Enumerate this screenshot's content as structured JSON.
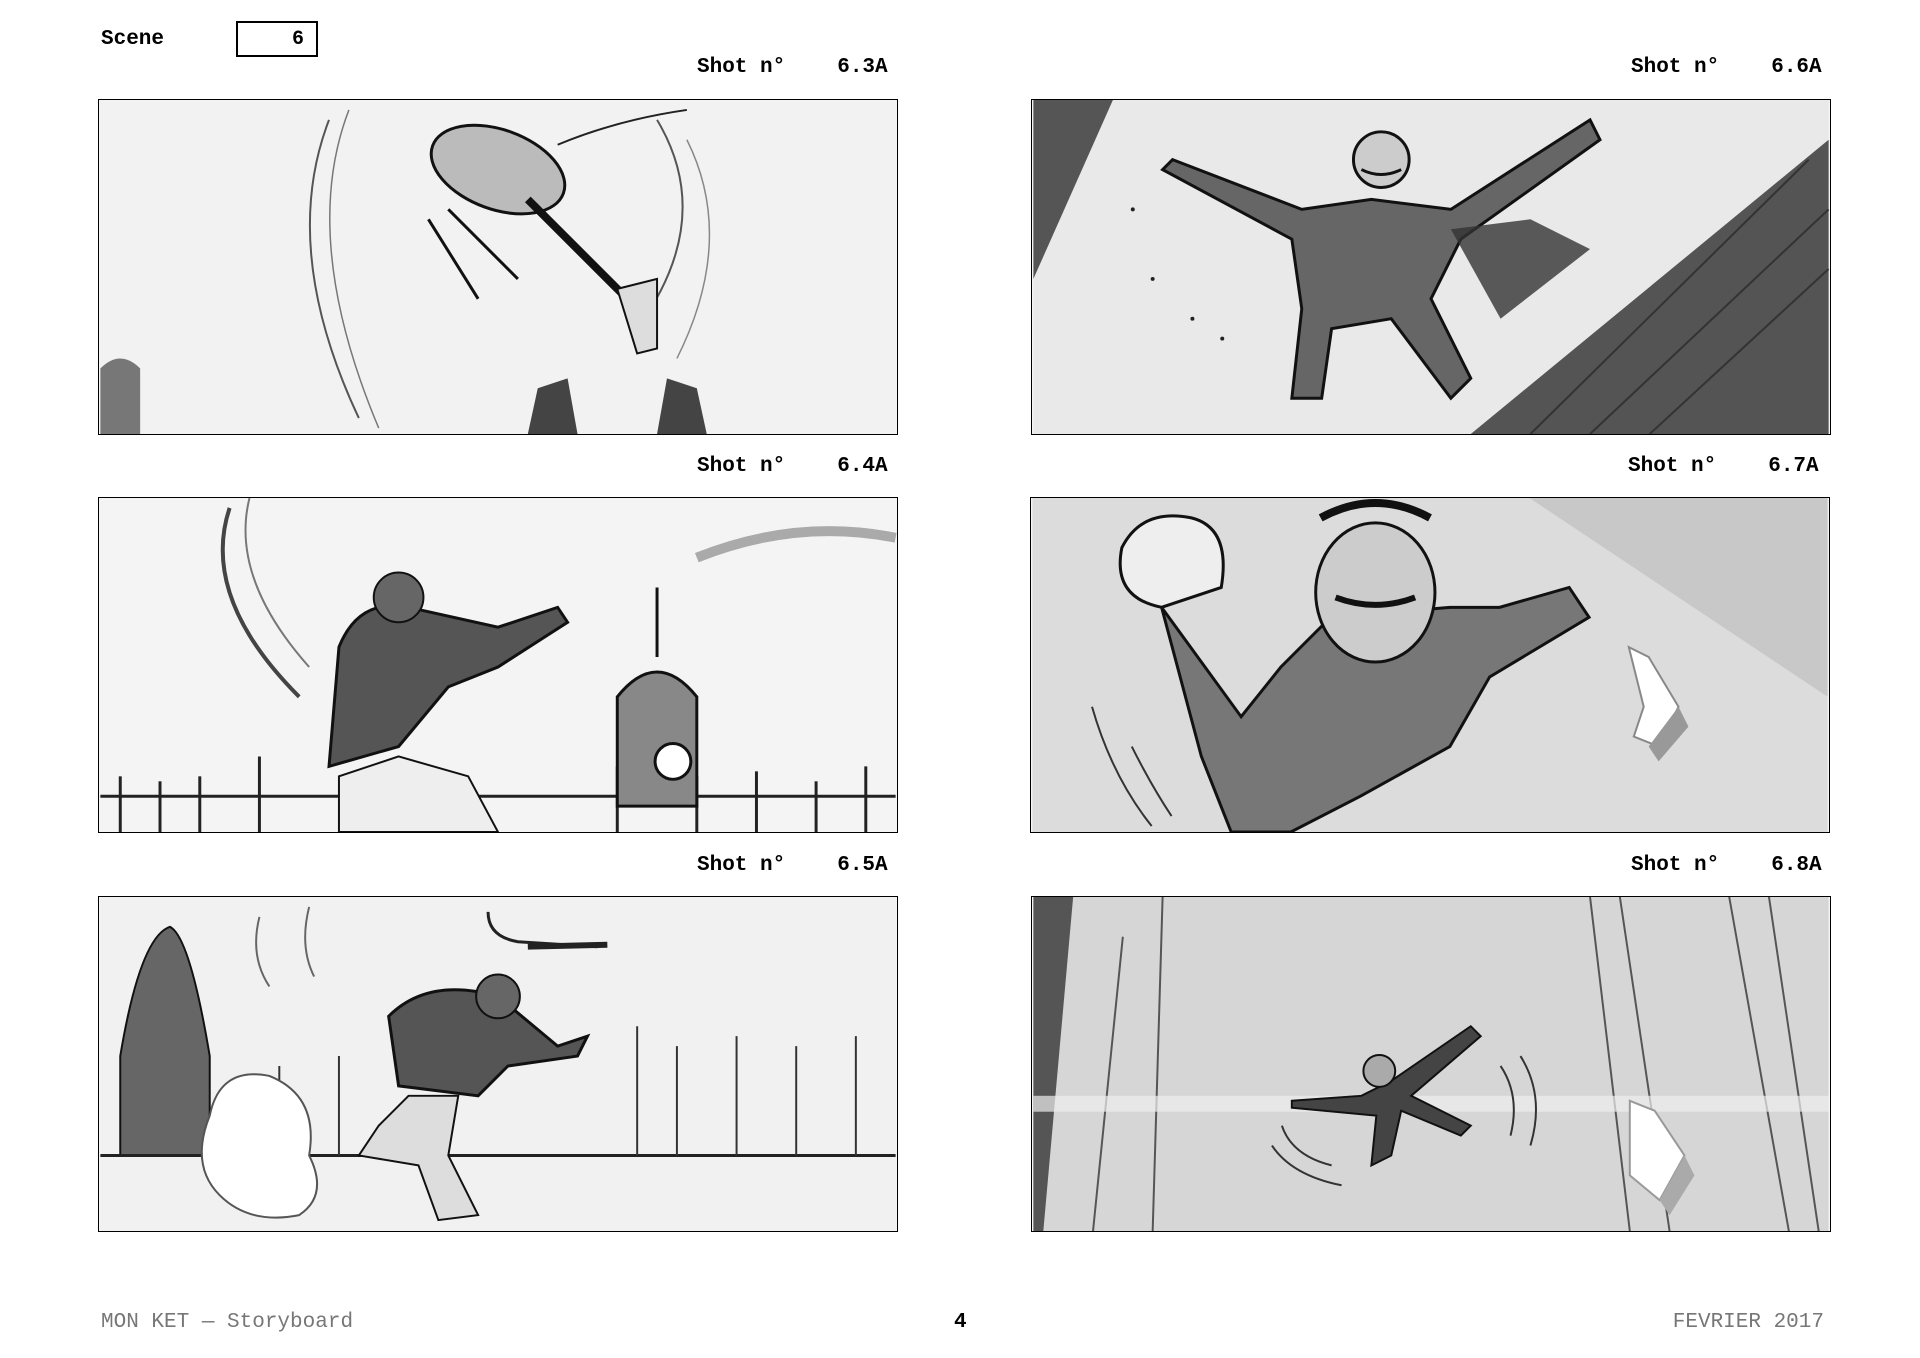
{
  "header": {
    "scene_label": "Scene",
    "scene_number": "6"
  },
  "shots": [
    {
      "label": "Shot n°",
      "number": "6.3A"
    },
    {
      "label": "Shot n°",
      "number": "6.4A"
    },
    {
      "label": "Shot n°",
      "number": "6.5A"
    },
    {
      "label": "Shot n°",
      "number": "6.6A"
    },
    {
      "label": "Shot n°",
      "number": "6.7A"
    },
    {
      "label": "Shot n°",
      "number": "6.8A"
    }
  ],
  "footer": {
    "title": "MON KET — Storyboard",
    "page": "4",
    "date": "FEVRIER 2017"
  }
}
